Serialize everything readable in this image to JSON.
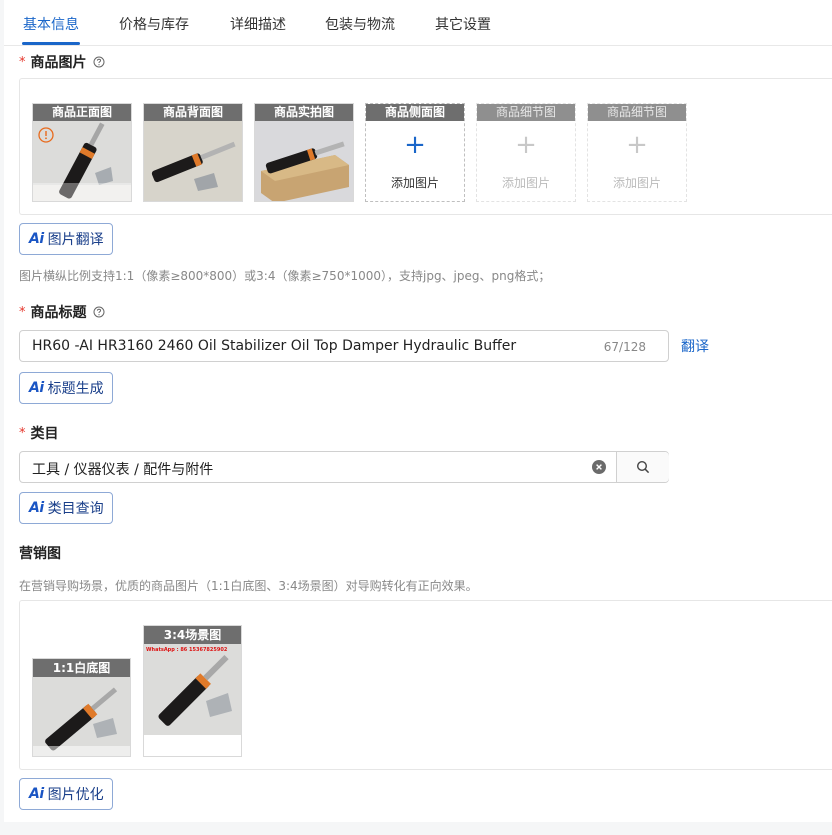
{
  "tabs": [
    {
      "label": "基本信息",
      "active": true
    },
    {
      "label": "价格与库存"
    },
    {
      "label": "详细描述"
    },
    {
      "label": "包装与物流"
    },
    {
      "label": "其它设置"
    }
  ],
  "images_section": {
    "required_mark": "*",
    "label": "商品图片",
    "help_icon": "question-circle-icon",
    "slots": [
      {
        "title": "商品正面图",
        "filled": true
      },
      {
        "title": "商品背面图",
        "filled": true
      },
      {
        "title": "商品实拍图",
        "filled": true
      },
      {
        "title": "商品侧面图",
        "add_label": "添加图片"
      },
      {
        "title": "商品细节图",
        "add_label": "添加图片",
        "disabled": true
      },
      {
        "title": "商品细节图",
        "add_label": "添加图片",
        "disabled": true
      }
    ],
    "ai_button": {
      "icon": "Ai",
      "label": "图片翻译"
    },
    "hint": "图片横纵比例支持1:1（像素≥800*800）或3:4（像素≥750*1000），支持jpg、jpeg、png格式；"
  },
  "title_section": {
    "required_mark": "*",
    "label": "商品标题",
    "help_icon": "question-circle-icon",
    "value": "HR60 -AI HR3160 2460 Oil Stabilizer Oil Top Damper Hydraulic Buffer",
    "counter": "67/128",
    "translate_link": "翻译",
    "ai_button": {
      "icon": "Ai",
      "label": "标题生成"
    }
  },
  "category_section": {
    "required_mark": "*",
    "label": "类目",
    "value": "工具 / 仪器仪表 / 配件与附件",
    "clear_icon": "clear-circle-icon",
    "search_icon": "search-icon",
    "ai_button": {
      "icon": "Ai",
      "label": "类目查询"
    }
  },
  "marketing_section": {
    "label": "营销图",
    "hint": "在营销导购场景，优质的商品图片（1:1白底图、3:4场景图）对导购转化有正向效果。",
    "slots": [
      {
        "title": "1:1白底图"
      },
      {
        "title": "3:4场景图",
        "overlay_text": "WhatsApp : 86 15367825902"
      }
    ],
    "ai_button": {
      "icon": "Ai",
      "label": "图片优化"
    }
  },
  "colors": {
    "accent": "#1a66c9",
    "required": "#e5352b",
    "slot_header": "#6e6e6e",
    "damper_body": "#1c1a1a",
    "damper_band": "#e07a2a"
  }
}
